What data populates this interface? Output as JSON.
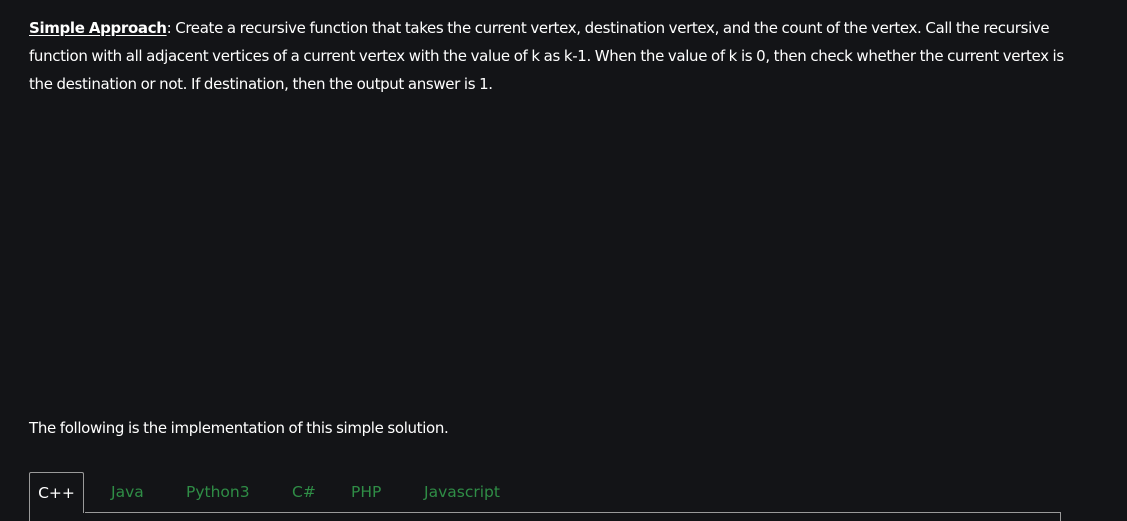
{
  "intro": {
    "lead": "Simple Approach",
    "text": ": Create a recursive function that takes the current vertex, destination vertex, and the count of the vertex. Call the recursive function with all adjacent vertices of a current vertex with the value of k as k-1. When the value of k is 0, then check whether the current vertex is the destination or not. If destination, then the output answer is 1."
  },
  "implementation_note": "The following is the implementation of this simple solution.",
  "tabs": [
    {
      "label": "C++",
      "active": true
    },
    {
      "label": "Java",
      "active": false
    },
    {
      "label": "Python3",
      "active": false
    },
    {
      "label": "C#",
      "active": false
    },
    {
      "label": "PHP",
      "active": false
    },
    {
      "label": "Javascript",
      "active": false
    }
  ],
  "colors": {
    "background": "#131417",
    "text": "#ffffff",
    "tab_inactive": "#2f8d46",
    "tab_border": "#9a9a9a"
  }
}
